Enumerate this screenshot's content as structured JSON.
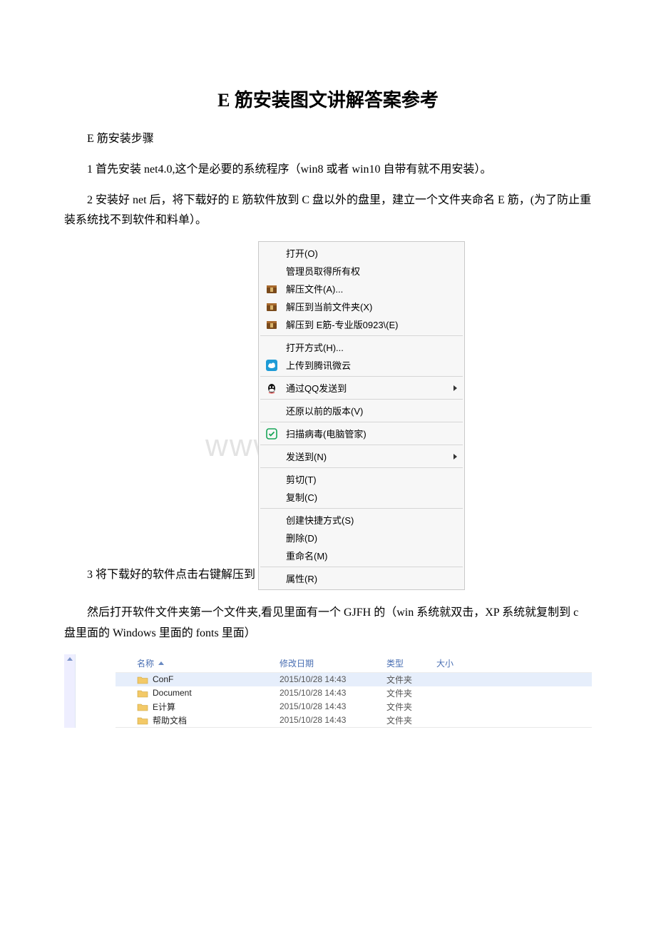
{
  "title": "E 筋安装图文讲解答案参考",
  "p_intro": "E 筋安装步骤",
  "p1": "1 首先安装 net4.0,这个是必要的系统程序（win8 或者 win10 自带有就不用安装）。",
  "p2": "2 安装好 net 后，将下载好的 E 筋软件放到 C 盘以外的盘里，建立一个文件夹命名 E 筋，(为了防止重装系统找不到软件和料单）。",
  "p3_lead": "3 将下载好的软件点击右键解压到",
  "p4": "然后打开软件文件夹第一个文件夹,看见里面有一个 GJFH 的（win 系统就双击，XP 系统就复制到 c 盘里面的 Windows 里面的 fonts 里面）",
  "watermark": "www.bdocx.com",
  "context_menu": {
    "groups": [
      [
        {
          "icon": "",
          "label": "打开(O)"
        },
        {
          "icon": "",
          "label": "管理员取得所有权"
        },
        {
          "icon": "archive",
          "label": "解压文件(A)..."
        },
        {
          "icon": "archive",
          "label": "解压到当前文件夹(X)"
        },
        {
          "icon": "archive",
          "label": "解压到 E筋-专业版0923\\(E)"
        }
      ],
      [
        {
          "icon": "",
          "label": "打开方式(H)..."
        },
        {
          "icon": "cloud",
          "label": "上传到腾讯微云"
        }
      ],
      [
        {
          "icon": "qq",
          "label": "通过QQ发送到",
          "submenu": true
        }
      ],
      [
        {
          "icon": "",
          "label": "还原以前的版本(V)"
        }
      ],
      [
        {
          "icon": "shield",
          "label": "扫描病毒(电脑管家)"
        }
      ],
      [
        {
          "icon": "",
          "label": "发送到(N)",
          "submenu": true
        }
      ],
      [
        {
          "icon": "",
          "label": "剪切(T)"
        },
        {
          "icon": "",
          "label": "复制(C)"
        }
      ],
      [
        {
          "icon": "",
          "label": "创建快捷方式(S)"
        },
        {
          "icon": "",
          "label": "删除(D)"
        },
        {
          "icon": "",
          "label": "重命名(M)"
        }
      ],
      [
        {
          "icon": "",
          "label": "属性(R)"
        }
      ]
    ]
  },
  "file_table": {
    "headers": {
      "name": "名称",
      "date": "修改日期",
      "type": "类型",
      "size": "大小"
    },
    "rows": [
      {
        "name": "ConF",
        "date": "2015/10/28 14:43",
        "type": "文件夹",
        "size": "",
        "selected": true
      },
      {
        "name": "Document",
        "date": "2015/10/28 14:43",
        "type": "文件夹",
        "size": ""
      },
      {
        "name": "E计算",
        "date": "2015/10/28 14:43",
        "type": "文件夹",
        "size": ""
      },
      {
        "name": "帮助文档",
        "date": "2015/10/28 14:43",
        "type": "文件夹",
        "size": ""
      }
    ]
  }
}
